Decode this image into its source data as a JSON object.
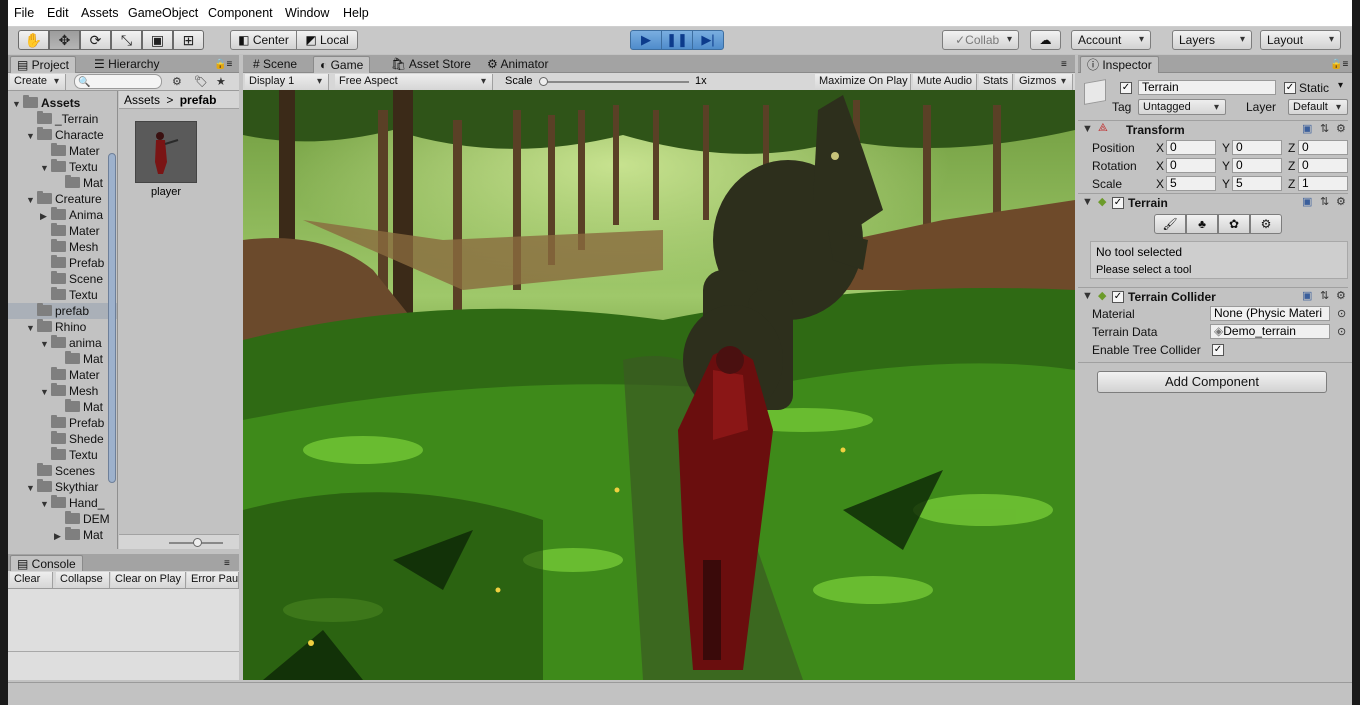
{
  "menu": [
    "File",
    "Edit",
    "Assets",
    "GameObject",
    "Component",
    "Window",
    "Help"
  ],
  "toolbar": {
    "pivot": "Center",
    "space": "Local",
    "collab": "Collab",
    "account": "Account",
    "layers": "Layers",
    "layout": "Layout"
  },
  "project_panel": {
    "tabs": [
      "Project",
      "Hierarchy"
    ],
    "create_label": "Create",
    "breadcrumb_root": "Assets",
    "breadcrumb_sep": ">",
    "breadcrumb_current": "prefab",
    "tree": [
      {
        "label": "Assets",
        "depth": 0,
        "arrow": "▼",
        "bold": true
      },
      {
        "label": "_Terrain",
        "depth": 1,
        "arrow": ""
      },
      {
        "label": "Characte",
        "depth": 1,
        "arrow": "▼"
      },
      {
        "label": "Mater",
        "depth": 2,
        "arrow": ""
      },
      {
        "label": "Textu",
        "depth": 2,
        "arrow": "▼"
      },
      {
        "label": "Mat",
        "depth": 3,
        "arrow": ""
      },
      {
        "label": "Creature",
        "depth": 1,
        "arrow": "▼"
      },
      {
        "label": "Anima",
        "depth": 2,
        "arrow": "▶"
      },
      {
        "label": "Mater",
        "depth": 2,
        "arrow": ""
      },
      {
        "label": "Mesh",
        "depth": 2,
        "arrow": ""
      },
      {
        "label": "Prefab",
        "depth": 2,
        "arrow": ""
      },
      {
        "label": "Scene",
        "depth": 2,
        "arrow": ""
      },
      {
        "label": "Textu",
        "depth": 2,
        "arrow": ""
      },
      {
        "label": "prefab",
        "depth": 1,
        "arrow": "",
        "selected": true
      },
      {
        "label": "Rhino",
        "depth": 1,
        "arrow": "▼"
      },
      {
        "label": "anima",
        "depth": 2,
        "arrow": "▼"
      },
      {
        "label": "Mat",
        "depth": 3,
        "arrow": ""
      },
      {
        "label": "Mater",
        "depth": 2,
        "arrow": ""
      },
      {
        "label": "Mesh",
        "depth": 2,
        "arrow": "▼"
      },
      {
        "label": "Mat",
        "depth": 3,
        "arrow": ""
      },
      {
        "label": "Prefab",
        "depth": 2,
        "arrow": ""
      },
      {
        "label": "Shede",
        "depth": 2,
        "arrow": ""
      },
      {
        "label": "Textu",
        "depth": 2,
        "arrow": ""
      },
      {
        "label": "Scenes",
        "depth": 1,
        "arrow": ""
      },
      {
        "label": "Skythiar",
        "depth": 1,
        "arrow": "▼"
      },
      {
        "label": "Hand_",
        "depth": 2,
        "arrow": "▼"
      },
      {
        "label": "DEM",
        "depth": 3,
        "arrow": ""
      },
      {
        "label": "Mat",
        "depth": 3,
        "arrow": "▶"
      }
    ],
    "asset_label": "player"
  },
  "console_panel": {
    "tab": "Console",
    "buttons": [
      "Clear",
      "Collapse",
      "Clear on Play",
      "Error Pau"
    ]
  },
  "view_tabs": [
    "Scene",
    "Game",
    "Asset Store",
    "Animator"
  ],
  "game_bar": {
    "display": "Display 1",
    "aspect": "Free Aspect",
    "scale_label": "Scale",
    "scale_value": "1x",
    "buttons": [
      "Maximize On Play",
      "Mute Audio",
      "Stats",
      "Gizmos"
    ]
  },
  "inspector": {
    "tab": "Inspector",
    "object_name": "Terrain",
    "static_label": "Static",
    "tag_label": "Tag",
    "tag_value": "Untagged",
    "layer_label": "Layer",
    "layer_value": "Default",
    "transform": {
      "title": "Transform",
      "position": {
        "label": "Position",
        "x": "0",
        "y": "0",
        "z": "0"
      },
      "rotation": {
        "label": "Rotation",
        "x": "0",
        "y": "0",
        "z": "0"
      },
      "scale": {
        "label": "Scale",
        "x": "5",
        "y": "5",
        "z": "1"
      }
    },
    "terrain": {
      "title": "Terrain",
      "status": "No tool selected",
      "hint": "Please select a tool"
    },
    "collider": {
      "title": "Terrain Collider",
      "material_label": "Material",
      "material_value": "None (Physic Materi",
      "data_label": "Terrain Data",
      "data_value": "Demo_terrain",
      "tree_label": "Enable Tree Collider"
    },
    "add_component": "Add Component"
  },
  "axis_letters": {
    "x": "X",
    "y": "Y",
    "z": "Z"
  }
}
